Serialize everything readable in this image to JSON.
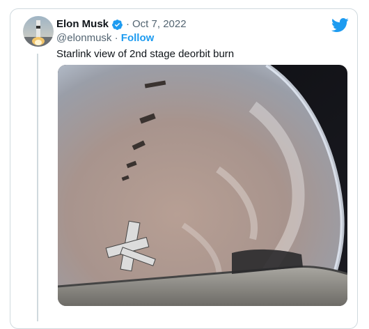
{
  "tweet": {
    "author_name": "Elon Musk",
    "separator": "·",
    "date": "Oct 7, 2022",
    "handle": "@elonmusk",
    "handle_separator": " · ",
    "follow_label": "Follow",
    "text": "Starlink view of 2nd stage deorbit burn"
  },
  "colors": {
    "accent": "#1d9bf0",
    "text": "#0f1419",
    "secondary": "#536471",
    "border": "#cfd9de"
  },
  "icons": {
    "verified": "verified-badge-icon",
    "brand": "twitter-bird-icon"
  }
}
